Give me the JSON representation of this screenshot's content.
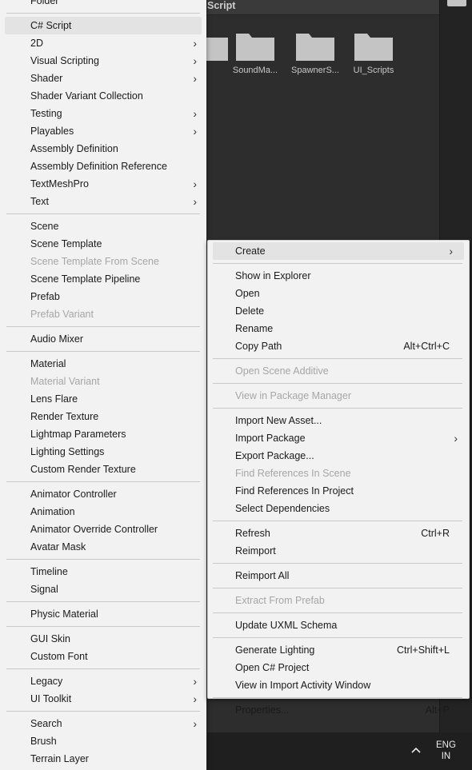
{
  "project": {
    "breadcrumb": "Script",
    "folders": [
      "SoundMa...",
      "SpawnerS...",
      "UI_Scripts"
    ],
    "folder_color": "#c4c4c4"
  },
  "taskbar": {
    "lang_top": "ENG",
    "lang_bottom": "IN",
    "chevron_icon": "chevron-up-icon"
  },
  "create_menu": {
    "items": [
      {
        "label": "Folder"
      },
      {
        "sep": true
      },
      {
        "label": "C# Script",
        "highlight": true
      },
      {
        "label": "2D",
        "arrow": true
      },
      {
        "label": "Visual Scripting",
        "arrow": true
      },
      {
        "label": "Shader",
        "arrow": true
      },
      {
        "label": "Shader Variant Collection"
      },
      {
        "label": "Testing",
        "arrow": true
      },
      {
        "label": "Playables",
        "arrow": true
      },
      {
        "label": "Assembly Definition"
      },
      {
        "label": "Assembly Definition Reference"
      },
      {
        "label": "TextMeshPro",
        "arrow": true
      },
      {
        "label": "Text",
        "arrow": true
      },
      {
        "sep": true
      },
      {
        "label": "Scene"
      },
      {
        "label": "Scene Template"
      },
      {
        "label": "Scene Template From Scene",
        "disabled": true
      },
      {
        "label": "Scene Template Pipeline"
      },
      {
        "label": "Prefab"
      },
      {
        "label": "Prefab Variant",
        "disabled": true
      },
      {
        "sep": true
      },
      {
        "label": "Audio Mixer"
      },
      {
        "sep": true
      },
      {
        "label": "Material"
      },
      {
        "label": "Material Variant",
        "disabled": true
      },
      {
        "label": "Lens Flare"
      },
      {
        "label": "Render Texture"
      },
      {
        "label": "Lightmap Parameters"
      },
      {
        "label": "Lighting Settings"
      },
      {
        "label": "Custom Render Texture"
      },
      {
        "sep": true
      },
      {
        "label": "Animator Controller"
      },
      {
        "label": "Animation"
      },
      {
        "label": "Animator Override Controller"
      },
      {
        "label": "Avatar Mask"
      },
      {
        "sep": true
      },
      {
        "label": "Timeline"
      },
      {
        "label": "Signal"
      },
      {
        "sep": true
      },
      {
        "label": "Physic Material"
      },
      {
        "sep": true
      },
      {
        "label": "GUI Skin"
      },
      {
        "label": "Custom Font"
      },
      {
        "sep": true
      },
      {
        "label": "Legacy",
        "arrow": true
      },
      {
        "label": "UI Toolkit",
        "arrow": true
      },
      {
        "sep": true
      },
      {
        "label": "Search",
        "arrow": true
      },
      {
        "label": "Brush"
      },
      {
        "label": "Terrain Layer"
      }
    ]
  },
  "context_menu": {
    "items": [
      {
        "label": "Create",
        "arrow": true,
        "highlight": true
      },
      {
        "sep": true
      },
      {
        "label": "Show in Explorer"
      },
      {
        "label": "Open"
      },
      {
        "label": "Delete"
      },
      {
        "label": "Rename"
      },
      {
        "label": "Copy Path",
        "shortcut": "Alt+Ctrl+C"
      },
      {
        "sep": true
      },
      {
        "label": "Open Scene Additive",
        "disabled": true
      },
      {
        "sep": true
      },
      {
        "label": "View in Package Manager",
        "disabled": true
      },
      {
        "sep": true
      },
      {
        "label": "Import New Asset..."
      },
      {
        "label": "Import Package",
        "arrow": true
      },
      {
        "label": "Export Package..."
      },
      {
        "label": "Find References In Scene",
        "disabled": true
      },
      {
        "label": "Find References In Project"
      },
      {
        "label": "Select Dependencies"
      },
      {
        "sep": true
      },
      {
        "label": "Refresh",
        "shortcut": "Ctrl+R"
      },
      {
        "label": "Reimport"
      },
      {
        "sep": true
      },
      {
        "label": "Reimport All"
      },
      {
        "sep": true
      },
      {
        "label": "Extract From Prefab",
        "disabled": true
      },
      {
        "sep": true
      },
      {
        "label": "Update UXML Schema"
      },
      {
        "sep": true
      },
      {
        "label": "Generate Lighting",
        "shortcut": "Ctrl+Shift+L"
      },
      {
        "label": "Open C# Project"
      },
      {
        "label": "View in Import Activity Window"
      },
      {
        "sep": true
      },
      {
        "label": "Properties...",
        "shortcut": "Alt+P"
      }
    ]
  }
}
